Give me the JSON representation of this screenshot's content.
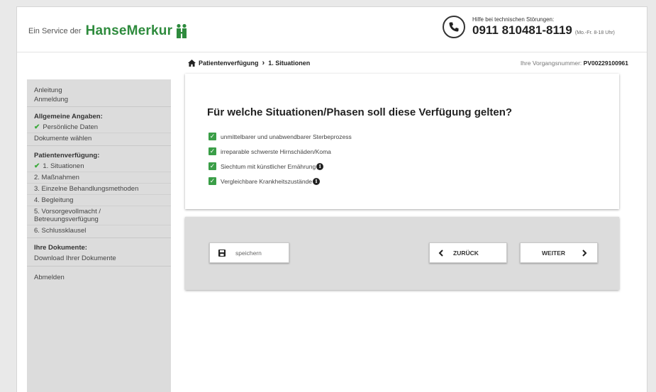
{
  "header": {
    "service_label": "Ein Service der",
    "brand_name": "HanseMerkur",
    "brand_color": "#2e8b3d",
    "hotline_label": "Hilfe bei technischen Störungen:",
    "hotline_number": "0911 810481-8119",
    "hotline_hours": "(Mo.-Fr. 8-18 Uhr)"
  },
  "breadcrumb": {
    "home_icon": "home-icon",
    "root": "Patientenverfügung",
    "current": "1. Situationen"
  },
  "vorgang": {
    "label": "Ihre Vorgangsnummer:",
    "number": "PV00229100961"
  },
  "sidebar": {
    "anleitung": "Anleitung",
    "anmeldung": "Anmeldung",
    "allgemeine_head": "Allgemeine Angaben:",
    "persoenliche": "Persönliche Daten",
    "dokumente_waehlen": "Dokumente wählen",
    "patienten_head": "Patientenverfügung:",
    "situationen": "1. Situationen",
    "massnahmen": "2. Maßnahmen",
    "behandlung": "3. Einzelne Behandlungsmethoden",
    "begleitung": "4. Begleitung",
    "vorsorge": "5. Vorsorgevollmacht / Betreuungsverfügung",
    "schluss": "6. Schlussklausel",
    "dokumente_head": "Ihre Dokumente:",
    "download": "Download Ihrer Dokumente",
    "abmelden": "Abmelden"
  },
  "question": {
    "title": "Für welche Situationen/Phasen soll diese Verfügung gelten?",
    "options": [
      {
        "label": "unmittelbarer und unabwendbarer Sterbeprozess",
        "checked": true
      },
      {
        "label": "irreparable schwerste Hirnschäden/Koma",
        "checked": true
      },
      {
        "label": "Siechtum mit künstlicher Ernährung",
        "checked": true,
        "info": true
      },
      {
        "label": "Vergleichbare Krankheitszustände",
        "checked": true,
        "info": true
      }
    ]
  },
  "actions": {
    "save": "speichern",
    "back": "ZURÜCK",
    "next": "WEITER"
  },
  "colors": {
    "checkbox": "#3a9e47",
    "sidebar_bg": "#dcdcdc"
  }
}
